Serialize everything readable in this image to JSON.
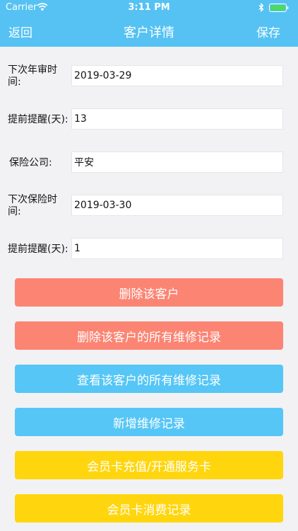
{
  "status_bar": {
    "carrier": "Carrier",
    "time": "3:11 PM",
    "icons": [
      "wifi-icon",
      "bluetooth-icon",
      "battery-icon"
    ]
  },
  "nav": {
    "back_label": "返回",
    "title": "客户详情",
    "save_label": "保存"
  },
  "form": {
    "rows": [
      {
        "label": "下次年审时间:",
        "value": "2019-03-29"
      },
      {
        "label": "提前提醒(天):",
        "value": "13"
      },
      {
        "label": "保险公司:",
        "value": "平安"
      },
      {
        "label": "下次保险时间:",
        "value": "2019-03-30"
      },
      {
        "label": "提前提醒(天):",
        "value": "1"
      }
    ]
  },
  "actions": [
    {
      "label": "删除该客户",
      "color": "#fb8473"
    },
    {
      "label": "删除该客户的所有维修记录",
      "color": "#fb8473"
    },
    {
      "label": "查看该客户的所有维修记录",
      "color": "#55c6f6"
    },
    {
      "label": "新增维修记录",
      "color": "#55c6f6"
    },
    {
      "label": "会员卡充值/开通服务卡",
      "color": "#ffd60e"
    },
    {
      "label": "会员卡消费记录",
      "color": "#ffd60e"
    }
  ],
  "colors": {
    "header": "#55c2f3",
    "background": "#f2f2f4",
    "battery": "#4cd964"
  }
}
